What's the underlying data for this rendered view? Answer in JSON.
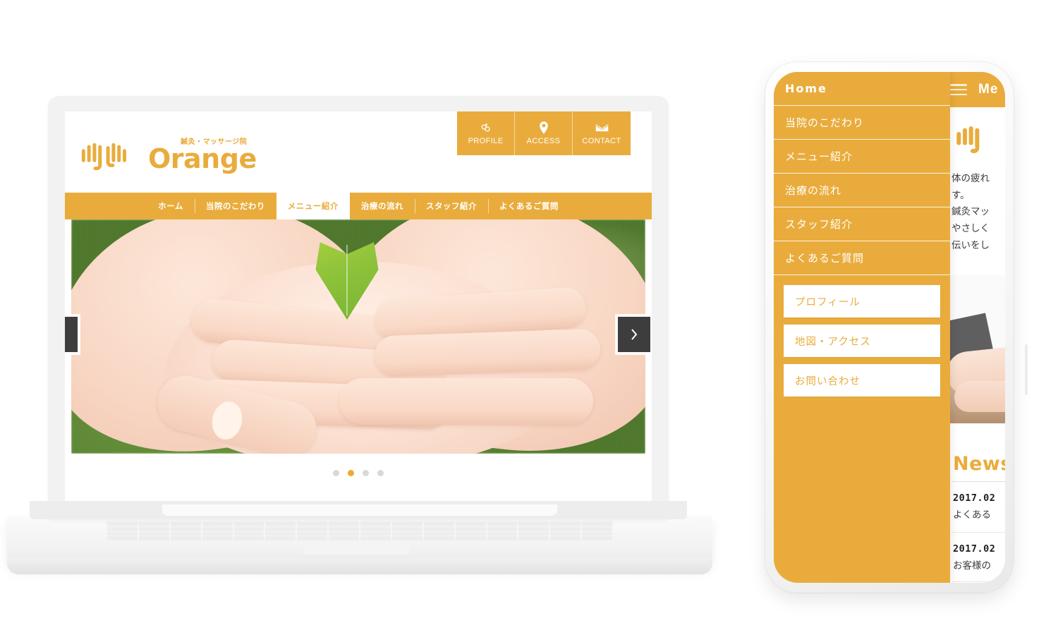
{
  "brand": {
    "accent": "#E9AC3C",
    "logo_tagline": "鍼灸・マッサージ院",
    "logo_word": "Orange"
  },
  "desktop": {
    "header_actions": [
      {
        "icon": "profile-icon",
        "label": "PROFILE"
      },
      {
        "icon": "location-pin-icon",
        "label": "ACCESS"
      },
      {
        "icon": "mail-icon",
        "label": "CONTACT"
      }
    ],
    "nav": [
      {
        "label": "ホーム",
        "active": false
      },
      {
        "label": "当院のこだわり",
        "active": false
      },
      {
        "label": "メニュー紹介",
        "active": true
      },
      {
        "label": "治療の流れ",
        "active": false
      },
      {
        "label": "スタッフ紹介",
        "active": false
      },
      {
        "label": "よくあるご質問",
        "active": false
      }
    ],
    "slider": {
      "dots": 4,
      "active_dot": 2,
      "prev_label": "‹",
      "next_label": "›"
    }
  },
  "mobile": {
    "topbar": {
      "menu_label": "Me",
      "burger": "hamburger-icon"
    },
    "lead_text": "体の疲れ\nす。\n鍼灸マッ\nやさしく\n伝いをし",
    "drawer": {
      "items": [
        {
          "label": "Home",
          "home": true
        },
        {
          "label": "当院のこだわり",
          "home": false
        },
        {
          "label": "メニュー紹介",
          "home": false
        },
        {
          "label": "治療の流れ",
          "home": false
        },
        {
          "label": "スタッフ紹介",
          "home": false
        },
        {
          "label": "よくあるご質問",
          "home": false
        }
      ],
      "buttons": [
        {
          "label": "プロフィール"
        },
        {
          "label": "地図・アクセス"
        },
        {
          "label": "お問い合わせ"
        }
      ]
    },
    "news": {
      "title": "News",
      "items": [
        {
          "date": "2017.02",
          "text": "よくある"
        },
        {
          "date": "2017.02",
          "text": "お客様の"
        }
      ]
    }
  }
}
